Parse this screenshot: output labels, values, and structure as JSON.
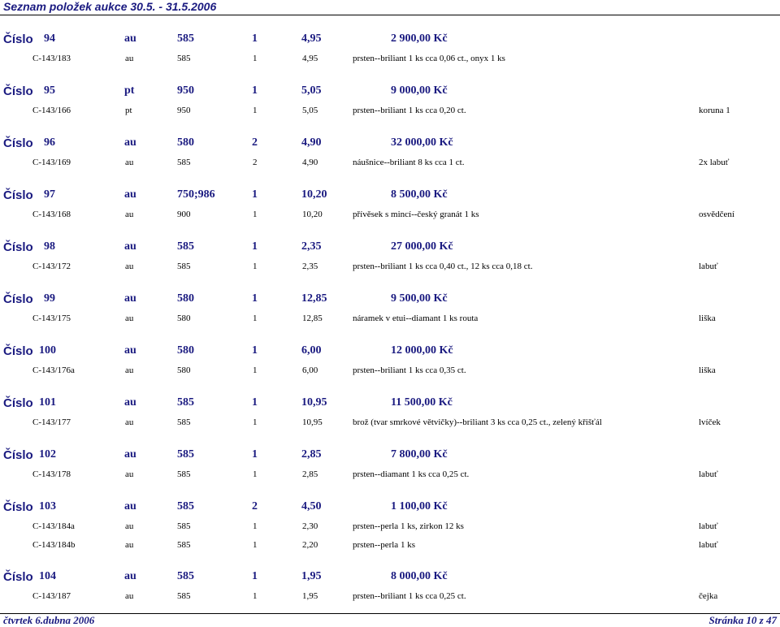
{
  "title": "Seznam položek aukce 30.5. - 31.5.2006",
  "cislo_label": "Číslo",
  "lots": [
    {
      "num": "94",
      "metal": "au",
      "ryzost": "585",
      "ks": "1",
      "weight": "4,95",
      "price": "2 900,00 Kč",
      "items": [
        {
          "inv": "C-143/183",
          "metal": "au",
          "ryzost": "585",
          "ks": "1",
          "weight": "4,95",
          "desc": "prsten--briliant 1 ks cca 0,06 ct., onyx 1 ks",
          "note": ""
        }
      ]
    },
    {
      "num": "95",
      "metal": "pt",
      "ryzost": "950",
      "ks": "1",
      "weight": "5,05",
      "price": "9 000,00 Kč",
      "items": [
        {
          "inv": "C-143/166",
          "metal": "pt",
          "ryzost": "950",
          "ks": "1",
          "weight": "5,05",
          "desc": "prsten--briliant 1 ks cca 0,20 ct.",
          "note": "koruna 1"
        }
      ]
    },
    {
      "num": "96",
      "metal": "au",
      "ryzost": "580",
      "ks": "2",
      "weight": "4,90",
      "price": "32 000,00 Kč",
      "items": [
        {
          "inv": "C-143/169",
          "metal": "au",
          "ryzost": "585",
          "ks": "2",
          "weight": "4,90",
          "desc": "náušnice--briliant 8 ks cca 1 ct.",
          "note": "2x labuť"
        }
      ]
    },
    {
      "num": "97",
      "metal": "au",
      "ryzost": "750;986",
      "ks": "1",
      "weight": "10,20",
      "price": "8 500,00 Kč",
      "items": [
        {
          "inv": "C-143/168",
          "metal": "au",
          "ryzost": "900",
          "ks": "1",
          "weight": "10,20",
          "desc": "přívěsek s mincí--český granát 1 ks",
          "note": "osvědčení"
        }
      ]
    },
    {
      "num": "98",
      "metal": "au",
      "ryzost": "585",
      "ks": "1",
      "weight": "2,35",
      "price": "27 000,00 Kč",
      "items": [
        {
          "inv": "C-143/172",
          "metal": "au",
          "ryzost": "585",
          "ks": "1",
          "weight": "2,35",
          "desc": "prsten--briliant 1 ks cca 0,40 ct., 12 ks cca 0,18 ct.",
          "note": "labuť"
        }
      ]
    },
    {
      "num": "99",
      "metal": "au",
      "ryzost": "580",
      "ks": "1",
      "weight": "12,85",
      "price": "9 500,00 Kč",
      "items": [
        {
          "inv": "C-143/175",
          "metal": "au",
          "ryzost": "580",
          "ks": "1",
          "weight": "12,85",
          "desc": "náramek v etui--diamant 1 ks routa",
          "note": "liška"
        }
      ]
    },
    {
      "num": "100",
      "metal": "au",
      "ryzost": "580",
      "ks": "1",
      "weight": "6,00",
      "price": "12 000,00 Kč",
      "items": [
        {
          "inv": "C-143/176a",
          "metal": "au",
          "ryzost": "580",
          "ks": "1",
          "weight": "6,00",
          "desc": "prsten--briliant 1 ks cca 0,35 ct.",
          "note": "liška"
        }
      ]
    },
    {
      "num": "101",
      "metal": "au",
      "ryzost": "585",
      "ks": "1",
      "weight": "10,95",
      "price": "11 500,00 Kč",
      "items": [
        {
          "inv": "C-143/177",
          "metal": "au",
          "ryzost": "585",
          "ks": "1",
          "weight": "10,95",
          "desc": "brož (tvar smrkové větvičky)--briliant 3 ks cca 0,25 ct., zelený křišťál",
          "note": "lvíček"
        }
      ]
    },
    {
      "num": "102",
      "metal": "au",
      "ryzost": "585",
      "ks": "1",
      "weight": "2,85",
      "price": "7 800,00 Kč",
      "items": [
        {
          "inv": "C-143/178",
          "metal": "au",
          "ryzost": "585",
          "ks": "1",
          "weight": "2,85",
          "desc": "prsten--diamant 1 ks cca 0,25 ct.",
          "note": "labuť"
        }
      ]
    },
    {
      "num": "103",
      "metal": "au",
      "ryzost": "585",
      "ks": "2",
      "weight": "4,50",
      "price": "1 100,00 Kč",
      "items": [
        {
          "inv": "C-143/184a",
          "metal": "au",
          "ryzost": "585",
          "ks": "1",
          "weight": "2,30",
          "desc": "prsten--perla 1 ks, zirkon 12 ks",
          "note": "labuť"
        },
        {
          "inv": "C-143/184b",
          "metal": "au",
          "ryzost": "585",
          "ks": "1",
          "weight": "2,20",
          "desc": "prsten--perla 1 ks",
          "note": "labuť"
        }
      ]
    },
    {
      "num": "104",
      "metal": "au",
      "ryzost": "585",
      "ks": "1",
      "weight": "1,95",
      "price": "8 000,00 Kč",
      "items": [
        {
          "inv": "C-143/187",
          "metal": "au",
          "ryzost": "585",
          "ks": "1",
          "weight": "1,95",
          "desc": "prsten--briliant 1 ks cca 0,25 ct.",
          "note": "čejka"
        }
      ]
    }
  ],
  "footer": {
    "date": "čtvrtek 6.dubna 2006",
    "page": "Stránka 10 z 47"
  }
}
